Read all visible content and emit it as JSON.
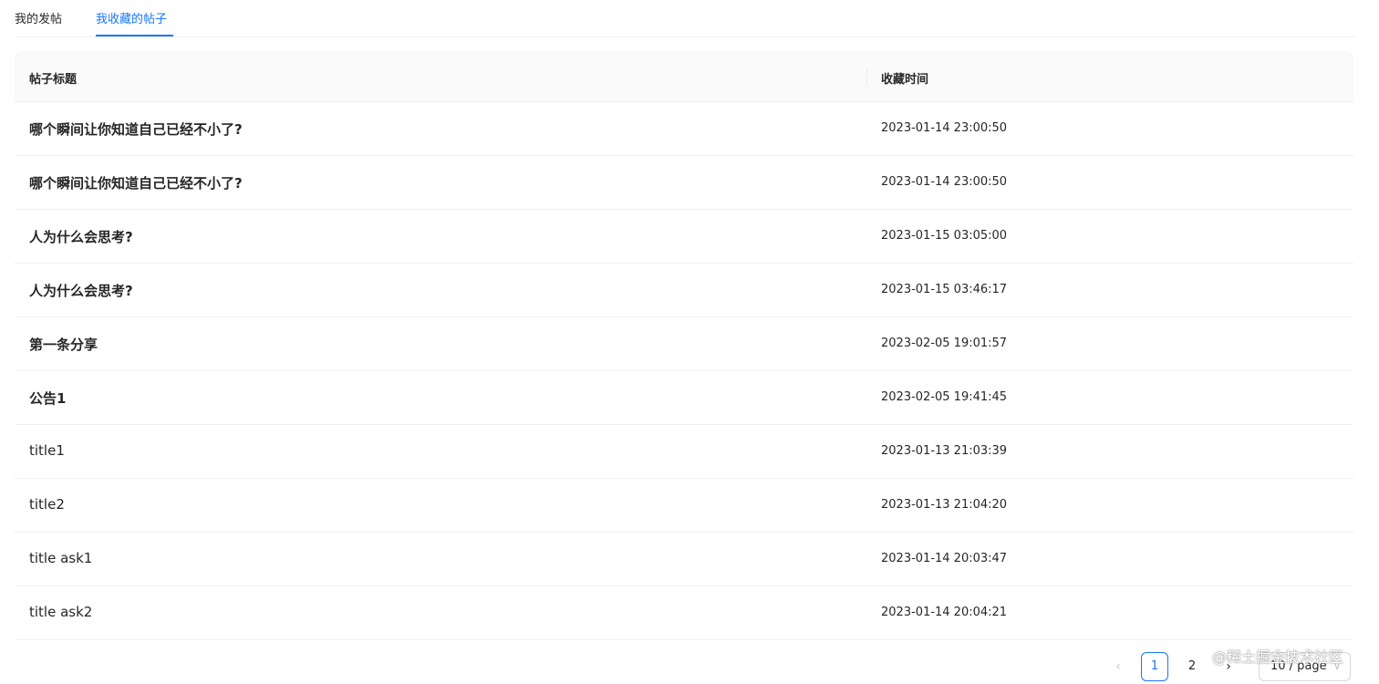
{
  "tabs": [
    {
      "label": "我的发帖",
      "active": false
    },
    {
      "label": "我收藏的帖子",
      "active": true
    }
  ],
  "colors": {
    "accent": "#1677ff",
    "header_bg": "#fafafa",
    "border": "#f0f0f0"
  },
  "table": {
    "columns": [
      "帖子标题",
      "收藏时间"
    ],
    "rows": [
      {
        "title": "哪个瞬间让你知道自己已经不小了?",
        "time": "2023-01-14 23:00:50"
      },
      {
        "title": "哪个瞬间让你知道自己已经不小了?",
        "time": "2023-01-14 23:00:50"
      },
      {
        "title": "人为什么会思考?",
        "time": "2023-01-15 03:05:00"
      },
      {
        "title": "人为什么会思考?",
        "time": "2023-01-15 03:46:17"
      },
      {
        "title": "第一条分享",
        "time": "2023-02-05 19:01:57"
      },
      {
        "title": "公告1",
        "time": "2023-02-05 19:41:45"
      },
      {
        "title": "title1",
        "time": "2023-01-13 21:03:39"
      },
      {
        "title": "title2",
        "time": "2023-01-13 21:04:20"
      },
      {
        "title": "title ask1",
        "time": "2023-01-14 20:03:47"
      },
      {
        "title": "title ask2",
        "time": "2023-01-14 20:04:21"
      }
    ]
  },
  "pagination": {
    "prev_icon": "left-chevron-icon",
    "pages": [
      "1",
      "2"
    ],
    "current": "1",
    "next_icon": "right-chevron-icon",
    "page_size": "10 / page"
  },
  "watermark": "@稀土掘金技术社区"
}
